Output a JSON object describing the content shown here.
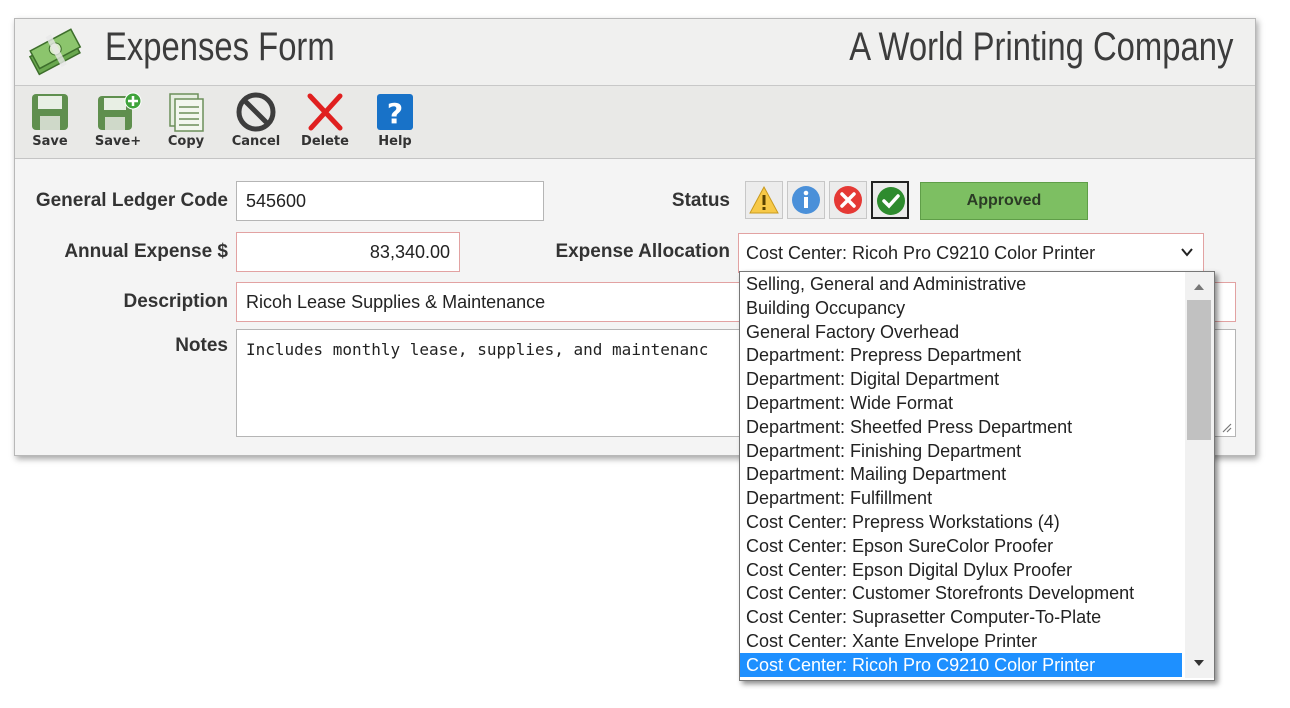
{
  "header": {
    "title": "Expenses Form",
    "company": "A World Printing Company"
  },
  "toolbar": {
    "buttons": [
      {
        "label": "Save",
        "icon": "save-icon"
      },
      {
        "label": "Save+",
        "icon": "save-plus-icon"
      },
      {
        "label": "Copy",
        "icon": "copy-icon"
      },
      {
        "label": "Cancel",
        "icon": "cancel-icon"
      },
      {
        "label": "Delete",
        "icon": "delete-icon"
      },
      {
        "label": "Help",
        "icon": "help-icon"
      }
    ]
  },
  "form": {
    "gl_code_label": "General Ledger Code",
    "gl_code_value": "545600",
    "annual_label": "Annual Expense $",
    "annual_value": "83,340.00",
    "description_label": "Description",
    "description_value": "Ricoh Lease Supplies & Maintenance",
    "notes_label": "Notes",
    "notes_value": "Includes monthly lease, supplies, and maintenanc",
    "status_label": "Status",
    "status_value": "Approved",
    "allocation_label": "Expense Allocation",
    "allocation_value": "Cost Center: Ricoh Pro C9210 Color Printer"
  },
  "allocation_options": [
    "Selling, General and Administrative",
    "Building Occupancy",
    "General Factory Overhead",
    "Department: Prepress Department",
    "Department: Digital Department",
    "Department: Wide Format",
    "Department: Sheetfed Press Department",
    "Department: Finishing Department",
    "Department: Mailing Department",
    "Department: Fulfillment",
    "Cost Center: Prepress Workstations (4)",
    "Cost Center: Epson SureColor Proofer",
    "Cost Center: Epson Digital Dylux Proofer",
    "Cost Center: Customer Storefronts Development",
    "Cost Center: Suprasetter Computer-To-Plate",
    "Cost Center: Xante Envelope Printer",
    "Cost Center: Ricoh Pro C9210 Color Printer"
  ],
  "colors": {
    "approved": "#7dbf62",
    "selected_option": "#1e90ff",
    "required_border": "#e2a2a2"
  }
}
